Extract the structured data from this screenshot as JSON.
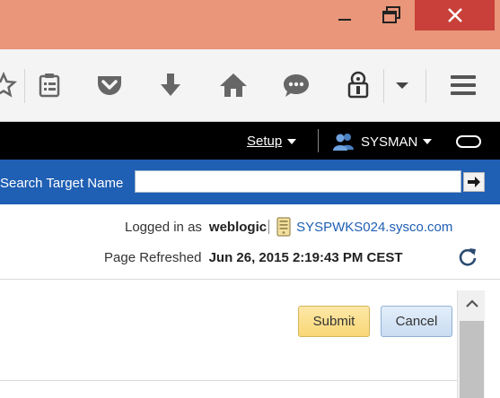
{
  "window": {
    "controls": [
      "minimize",
      "maximize",
      "close"
    ]
  },
  "toolbar": {
    "icons": [
      "star-icon",
      "reading-list-icon",
      "pocket-icon",
      "download-icon",
      "home-icon",
      "chat-icon",
      "extension-icon",
      "dropdown-icon",
      "menu-icon"
    ]
  },
  "header": {
    "setup_label": "Setup",
    "user_label": "SYSMAN"
  },
  "search": {
    "label": "Search Target Name",
    "value": "",
    "placeholder": ""
  },
  "info": {
    "logged_in_label": "Logged in as",
    "username": "weblogic",
    "host": "SYSPWKS024.sysco.com",
    "refreshed_label": "Page Refreshed",
    "timestamp": "Jun 26, 2015 2:19:43 PM CEST"
  },
  "actions": {
    "submit_label": "Submit",
    "cancel_label": "Cancel"
  },
  "colors": {
    "titlebar": "#e9967a",
    "close_button": "#c9403a",
    "appbar": "#000000",
    "searchbar": "#1f5fb4",
    "submit": "#f8d775",
    "cancel": "#c9dcf2",
    "link": "#1f5fb4"
  }
}
